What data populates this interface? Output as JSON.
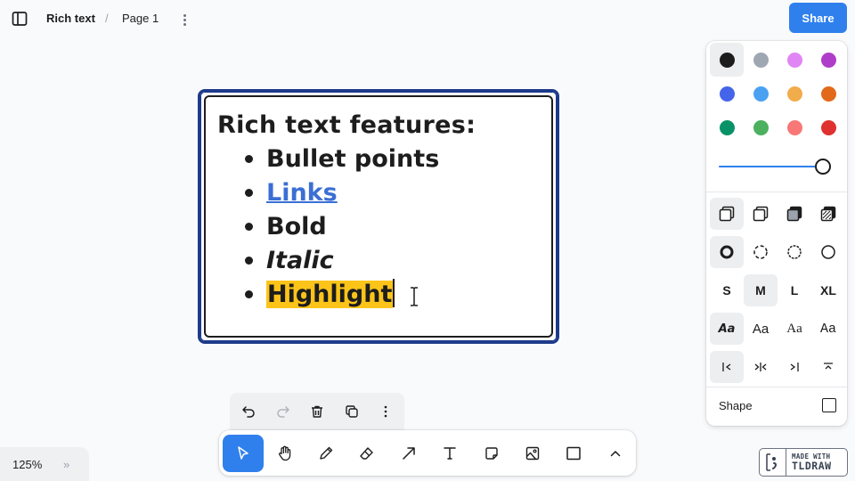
{
  "header": {
    "doc_title": "Rich text",
    "separator": "/",
    "page_name": "Page 1",
    "share_label": "Share"
  },
  "shape_text": {
    "title": "Rich text features:",
    "items": [
      "Bullet points",
      "Links",
      "Bold",
      "Italic",
      "Highlight"
    ]
  },
  "style_panel": {
    "colors": [
      {
        "name": "black",
        "hex": "#1d1d1d"
      },
      {
        "name": "grey",
        "hex": "#9fa8b2"
      },
      {
        "name": "light-violet",
        "hex": "#e085f4"
      },
      {
        "name": "violet",
        "hex": "#ae3ec9"
      },
      {
        "name": "blue",
        "hex": "#4465e9"
      },
      {
        "name": "light-blue",
        "hex": "#4ba1f1"
      },
      {
        "name": "yellow",
        "hex": "#f1ac4b"
      },
      {
        "name": "orange",
        "hex": "#e16919"
      },
      {
        "name": "green",
        "hex": "#099268"
      },
      {
        "name": "light-green",
        "hex": "#4cb05e"
      },
      {
        "name": "light-red",
        "hex": "#f87777"
      },
      {
        "name": "red",
        "hex": "#e03131"
      }
    ],
    "selected_color": "black",
    "opacity": 1,
    "sizes": [
      "S",
      "M",
      "L",
      "XL"
    ],
    "selected_size": "M",
    "font_labels": [
      "Aa",
      "Aa",
      "Aa",
      "Aa"
    ],
    "shape_label": "Shape"
  },
  "zoom": {
    "value": "125%",
    "expand": "»"
  },
  "badge": {
    "line1": "MADE WITH",
    "line2": "TLDRAW"
  }
}
